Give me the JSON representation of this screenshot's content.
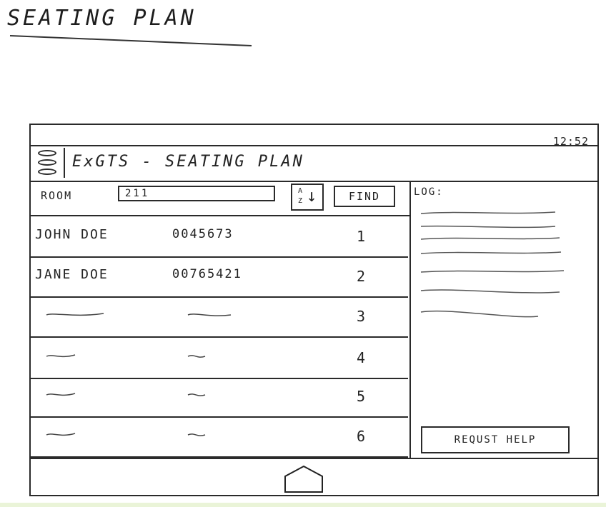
{
  "sheet": {
    "title": "SEATING PLAN"
  },
  "device": {
    "status_bar": {
      "clock": "12:52"
    },
    "header": {
      "menu_icon": "hamburger-menu-icon",
      "title": "ExGTS - SEATING PLAN"
    },
    "toolbar": {
      "room_label": "ROOM",
      "room_value": "211",
      "sort_icon": "sort-az-icon",
      "sort_top": "A",
      "sort_bottom": "Z",
      "find_label": "FIND"
    },
    "students": [
      {
        "name": "JOHN DOE",
        "id": "0045673",
        "seat": "1"
      },
      {
        "name": "JANE DOE",
        "id": "00765421",
        "seat": "2"
      },
      {
        "name": "",
        "id": "",
        "seat": "3"
      },
      {
        "name": "",
        "id": "",
        "seat": "4"
      },
      {
        "name": "",
        "id": "",
        "seat": "5"
      },
      {
        "name": "",
        "id": "",
        "seat": "6"
      }
    ],
    "log": {
      "label": "LOG:"
    },
    "request_help_label": "REQUST HELP",
    "nav": {
      "home_icon": "home-icon"
    }
  }
}
